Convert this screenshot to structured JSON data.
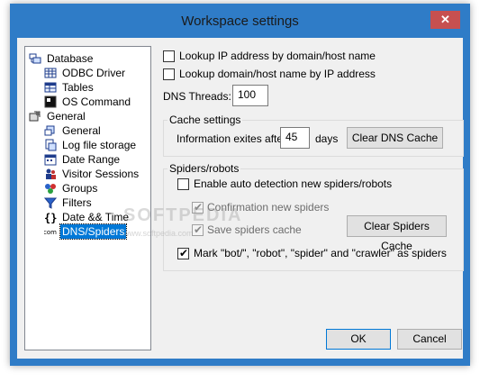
{
  "window": {
    "title": "Workspace settings",
    "close_glyph": "✕"
  },
  "tree": {
    "items": [
      {
        "label": "Database",
        "icon": "database-icon",
        "level": 0
      },
      {
        "label": "ODBC Driver",
        "icon": "grid-icon",
        "level": 1
      },
      {
        "label": "Tables",
        "icon": "table-icon",
        "level": 1
      },
      {
        "label": "OS Command",
        "icon": "terminal-icon",
        "level": 1
      },
      {
        "label": "General",
        "icon": "general-icon",
        "level": 0
      },
      {
        "label": "General",
        "icon": "general-sub-icon",
        "level": 1
      },
      {
        "label": "Log file storage",
        "icon": "log-storage-icon",
        "level": 1
      },
      {
        "label": "Date Range",
        "icon": "calendar-icon",
        "level": 1
      },
      {
        "label": "Visitor Sessions",
        "icon": "visitors-icon",
        "level": 1
      },
      {
        "label": "Groups",
        "icon": "groups-icon",
        "level": 1
      },
      {
        "label": "Filters",
        "icon": "filter-icon",
        "level": 1
      },
      {
        "label": "Date && Time",
        "icon": "braces-icon",
        "level": 1
      },
      {
        "label": "DNS/Spiders",
        "icon": "com-icon",
        "level": 1,
        "selected": true
      }
    ]
  },
  "options": {
    "lookup_ip": {
      "label": "Lookup IP address by domain/host name",
      "checked": false
    },
    "lookup_domain": {
      "label": "Lookup domain/host name by IP address",
      "checked": false
    },
    "dns_threads_label": "DNS Threads:",
    "dns_threads_value": "100"
  },
  "cache": {
    "title": "Cache settings",
    "expires_label": "Information exites after",
    "expires_value": "45",
    "days_label": "days",
    "clear_button": "Clear DNS Cache"
  },
  "spiders": {
    "title": "Spiders/robots",
    "enable_auto": {
      "label": "Enable auto detection new spiders/robots",
      "checked": false
    },
    "confirm": {
      "label": "Confirmation new spiders",
      "checked": true,
      "disabled": true
    },
    "save_cache": {
      "label": "Save spiders cache",
      "checked": true,
      "disabled": true
    },
    "clear_button": "Clear Spiders Cache",
    "mark_bots": {
      "label": "Mark \"bot/\", \"robot\", \"spider\" and \"crawler\" as spiders",
      "checked": true
    }
  },
  "footer": {
    "ok": "OK",
    "cancel": "Cancel"
  },
  "watermark": {
    "brand": "SOFTPEDIA",
    "url": "www.softpedia.com"
  },
  "colors": {
    "title_bar": "#2f7cc7",
    "close_button": "#c75050",
    "selection": "#0078d7",
    "dialog_bg": "#f0f0f0"
  }
}
